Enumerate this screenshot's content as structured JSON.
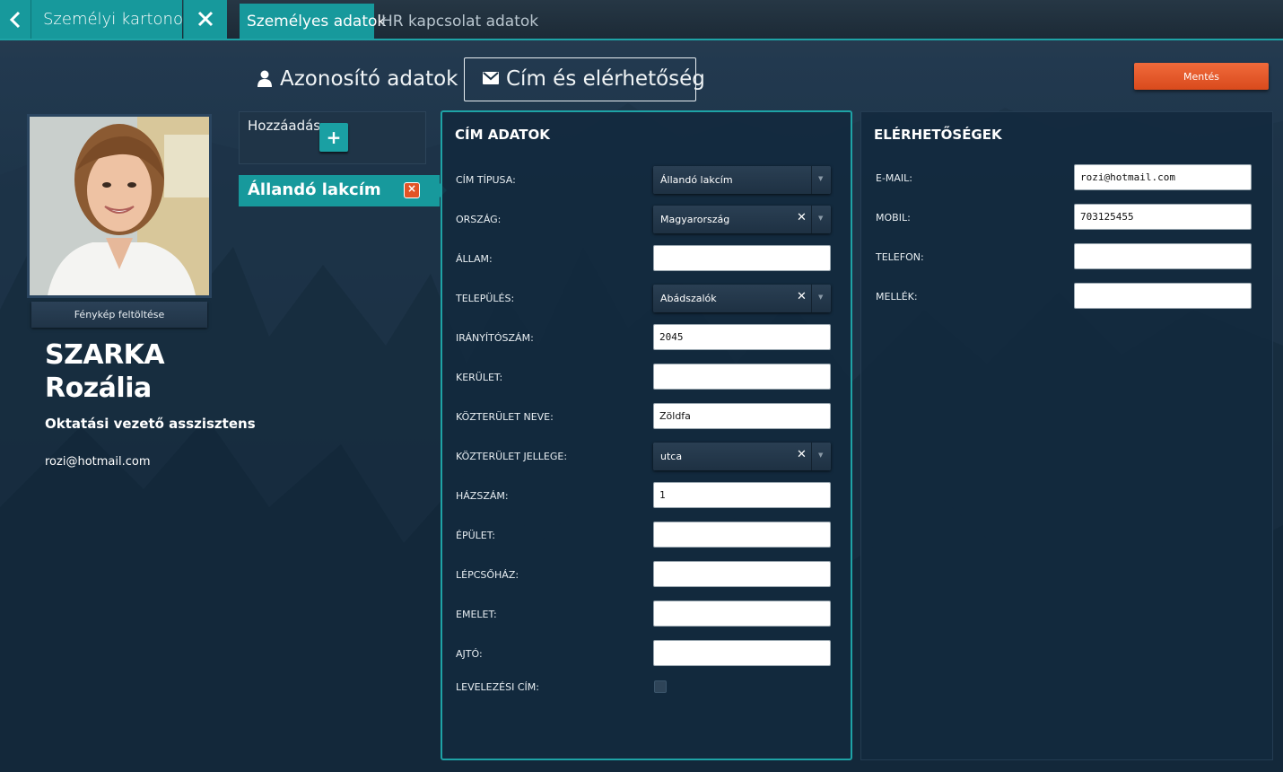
{
  "topbar": {
    "title": "Személyi kartonok",
    "tabs": [
      {
        "label": "Személyes adatok",
        "active": true
      },
      {
        "label": "HR kapcsolat adatok",
        "active": false
      }
    ]
  },
  "section_tabs": [
    {
      "label": "Azonosító adatok",
      "icon": "user-icon",
      "active": false
    },
    {
      "label": "Cím és elérhetőség",
      "icon": "envelope-icon",
      "active": true
    }
  ],
  "save_label": "Mentés",
  "profile": {
    "upload_label": "Fénykép feltöltése",
    "last_name": "SZARKA",
    "first_name": "Rozália",
    "job_title": "Oktatási vezető asszisztens",
    "email": "rozi@hotmail.com"
  },
  "address_list": {
    "add_label": "Hozzáadás",
    "add_icon": "+",
    "items": [
      {
        "label": "Állandó lakcím",
        "selected": true
      }
    ],
    "remove_icon": "×"
  },
  "address_panel": {
    "title": "CÍM ADATOK",
    "labels": {
      "type": "CÍM TÍPUSA:",
      "country": "ORSZÁG:",
      "state": "ÁLLAM:",
      "city": "TELEPÜLÉS:",
      "zip": "IRÁNYÍTÓSZÁM:",
      "district": "KERÜLET:",
      "street": "KÖZTERÜLET NEVE:",
      "street_type": "KÖZTERÜLET JELLEGE:",
      "house": "HÁZSZÁM:",
      "building": "ÉPÜLET:",
      "staircase": "LÉPCSŐHÁZ:",
      "floor": "EMELET:",
      "door": "AJTÓ:",
      "mailing": "LEVELEZÉSI CÍM:"
    },
    "values": {
      "type": "Állandó lakcím",
      "country": "Magyarország",
      "state": "",
      "city": "Abádszalók",
      "zip": "2045",
      "district": "",
      "street": "Zöldfa",
      "street_type": "utca",
      "house": "1",
      "building": "",
      "staircase": "",
      "floor": "",
      "door": "",
      "mailing": false
    },
    "clear_icon": "✕",
    "dropdown_icon": "▼"
  },
  "contact_panel": {
    "title": "ELÉRHETŐSÉGEK",
    "labels": {
      "email": "E-MAIL:",
      "mobile": "MOBIL:",
      "phone": "TELEFON:",
      "extension": "MELLÉK:"
    },
    "values": {
      "email": "rozi@hotmail.com",
      "mobile": "703125455",
      "phone": "",
      "extension": ""
    }
  },
  "colors": {
    "accent": "#17999c",
    "save": "#e25426",
    "background": "#1c3347"
  }
}
